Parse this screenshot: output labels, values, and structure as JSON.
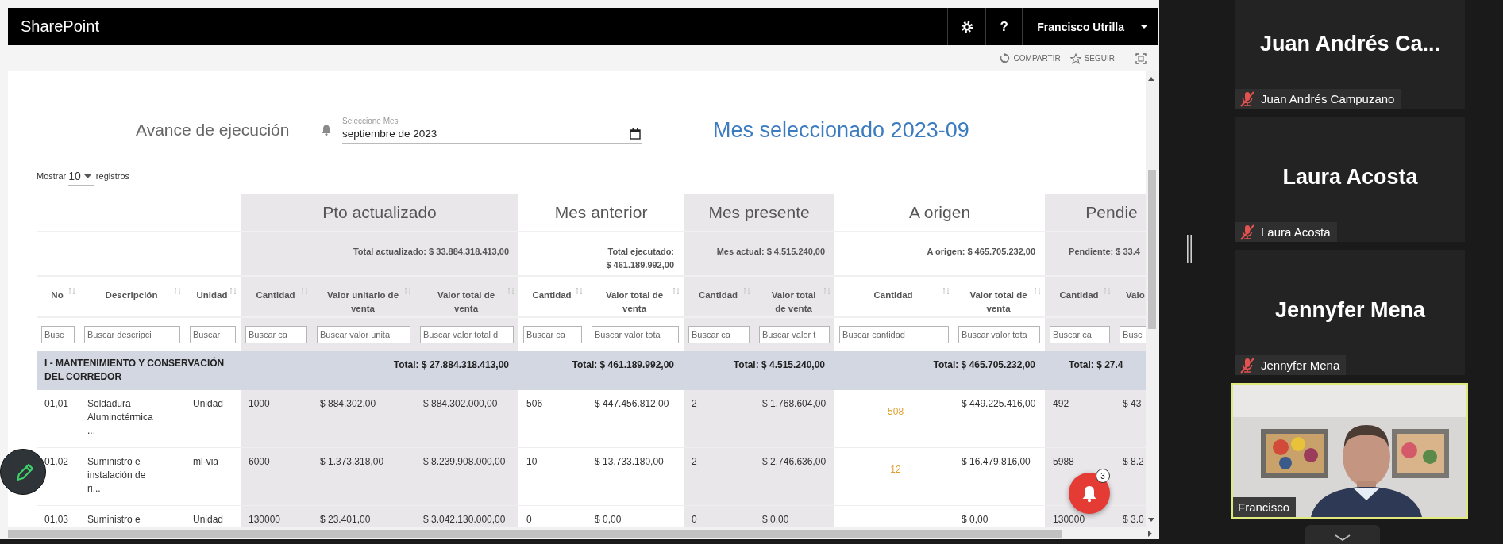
{
  "app": {
    "title": "SharePoint",
    "help": "?",
    "user": "Francisco Utrilla"
  },
  "commands": [
    {
      "kind": "share",
      "label": "COMPARTIR"
    },
    {
      "kind": "follow",
      "label": "SEGUIR"
    }
  ],
  "page": {
    "title": "Avance de ejecución",
    "month_picker": {
      "label": "Seleccione Mes",
      "value": "septiembre de 2023"
    },
    "selected_month": "Mes seleccionado 2023-09",
    "length": {
      "prefix": "Mostrar",
      "value": "10",
      "suffix": "registros"
    }
  },
  "table": {
    "groups": [
      {
        "columns": [
          {
            "label": "No",
            "placeholder": "Busc"
          },
          {
            "label": "Descripción",
            "placeholder": "Buscar descripci"
          },
          {
            "label": "Unidad",
            "placeholder": "Buscar"
          }
        ]
      },
      {
        "title": "Pto actualizado",
        "summary": "Total actualizado: $ 33.884.318.413,00",
        "shaded": true,
        "columns": [
          {
            "label": "Cantidad",
            "placeholder": "Buscar ca"
          },
          {
            "label": "Valor unitario de venta",
            "placeholder": "Buscar valor unita"
          },
          {
            "label": "Valor total de venta",
            "placeholder": "Buscar valor total d"
          }
        ]
      },
      {
        "title": "Mes anterior",
        "summary": "Total ejecutado:\n$ 461.189.992,00",
        "shaded": false,
        "columns": [
          {
            "label": "Cantidad",
            "placeholder": "Buscar ca"
          },
          {
            "label": "Valor total de venta",
            "placeholder": "Buscar valor tota"
          }
        ]
      },
      {
        "title": "Mes presente",
        "summary": "Mes actual: $ 4.515.240,00",
        "shaded": true,
        "columns": [
          {
            "label": "Cantidad",
            "placeholder": "Buscar ca"
          },
          {
            "label": "Valor total de venta",
            "placeholder": "Buscar valor t"
          }
        ]
      },
      {
        "title": "A origen",
        "summary": "A origen: $ 465.705.232,00",
        "shaded": false,
        "columns": [
          {
            "label": "Cantidad",
            "placeholder": "Buscar cantidad"
          },
          {
            "label": "Valor total de venta",
            "placeholder": "Buscar valor tota"
          }
        ]
      },
      {
        "title": "Pendie",
        "summary": "Pendiente: $ 33.4",
        "shaded": true,
        "columns": [
          {
            "label": "Cantidad",
            "placeholder": "Buscar ca"
          },
          {
            "label": "Valo",
            "placeholder": "Busc"
          }
        ]
      }
    ],
    "rows": [
      {
        "kind": "section",
        "title": "I - MANTENIMIENTO Y CONSERVACIÓN DEL CORREDOR",
        "totals": [
          "Total: $ 27.884.318.413,00",
          "Total: $ 461.189.992,00",
          "Total: $ 4.515.240,00",
          "Total: $ 465.705.232,00",
          "Total: $ 27.4"
        ]
      },
      {
        "kind": "item",
        "cells": [
          "01,01",
          "Soldadura Aluminotérmica ...",
          "Unidad",
          "1000",
          "$ 884.302,00",
          "$ 884.302.000,00",
          "506",
          "$ 447.456.812,00",
          "2",
          "$ 1.768.604,00",
          "508",
          "$ 449.225.416,00",
          "492",
          "$ 43"
        ]
      },
      {
        "kind": "item",
        "cells": [
          "01,02",
          "Suministro e instalación de ri...",
          "ml-via",
          "6000",
          "$ 1.373.318,00",
          "$ 8.239.908.000,00",
          "10",
          "$ 13.733.180,00",
          "2",
          "$ 2.746.636,00",
          "12",
          "$ 16.479.816,00",
          "5988",
          "$ 8.2"
        ]
      },
      {
        "kind": "item",
        "cells": [
          "01,03",
          "Suministro e",
          "Unidad",
          "130000",
          "$ 23.401,00",
          "$ 3.042.130.000,00",
          "0",
          "$ 0,00",
          "0",
          "$ 0,00",
          null,
          "$ 0,00",
          "130000",
          "$ 3.0"
        ]
      }
    ]
  },
  "notifications": {
    "count": "3"
  },
  "participants": [
    {
      "kind": "tile",
      "display_name": "Juan Andrés Ca...",
      "label": "Juan Andrés Campuzano",
      "muted": true
    },
    {
      "kind": "tile",
      "display_name": "Laura Acosta",
      "label": "Laura Acosta",
      "muted": true
    },
    {
      "kind": "tile",
      "display_name": "Jennyfer Mena",
      "label": "Jennyfer Mena",
      "muted": true
    },
    {
      "kind": "video",
      "label": "Francisco",
      "speaking": true
    }
  ]
}
